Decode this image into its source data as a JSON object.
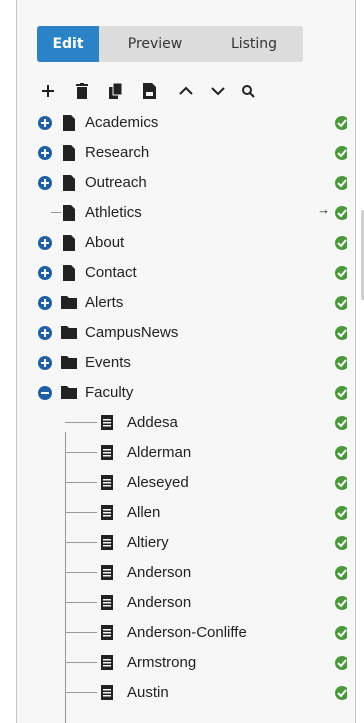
{
  "tabs": [
    {
      "label": "Edit",
      "active": true
    },
    {
      "label": "Preview",
      "active": false
    },
    {
      "label": "Listing",
      "active": false
    }
  ],
  "toolbar": {
    "items": [
      "add-icon",
      "delete-icon",
      "copy-icon",
      "paste-icon",
      "move-up-icon",
      "move-down-icon",
      "search-icon"
    ]
  },
  "tree": {
    "items": [
      {
        "label": "Academics",
        "type": "page",
        "expander": "plus",
        "status": "published"
      },
      {
        "label": "Research",
        "type": "page",
        "expander": "plus",
        "status": "published"
      },
      {
        "label": "Outreach",
        "type": "page",
        "expander": "plus",
        "status": "published"
      },
      {
        "label": "Athletics",
        "type": "page",
        "expander": "none",
        "status": "published",
        "redirect": true
      },
      {
        "label": "About",
        "type": "page",
        "expander": "plus",
        "status": "published"
      },
      {
        "label": "Contact",
        "type": "page",
        "expander": "plus",
        "status": "published"
      },
      {
        "label": "Alerts",
        "type": "folder",
        "expander": "plus",
        "status": "published"
      },
      {
        "label": "CampusNews",
        "type": "folder",
        "expander": "plus",
        "status": "published"
      },
      {
        "label": "Events",
        "type": "folder",
        "expander": "plus",
        "status": "published"
      },
      {
        "label": "Faculty",
        "type": "folder",
        "expander": "minus",
        "status": "published"
      }
    ],
    "faculty_children": [
      {
        "label": "Addesa",
        "status": "published"
      },
      {
        "label": "Alderman",
        "status": "published"
      },
      {
        "label": "Aleseyed",
        "status": "published"
      },
      {
        "label": "Allen",
        "status": "published"
      },
      {
        "label": "Altiery",
        "status": "published"
      },
      {
        "label": "Anderson",
        "status": "published"
      },
      {
        "label": "Anderson",
        "status": "published"
      },
      {
        "label": "Anderson-Conliffe",
        "status": "published"
      },
      {
        "label": "Armstrong",
        "status": "published"
      },
      {
        "label": "Austin",
        "status": "published"
      }
    ]
  },
  "colors": {
    "accent": "#2a83c6",
    "expander": "#1f5fa8",
    "status_ok": "#4a9a3c"
  }
}
